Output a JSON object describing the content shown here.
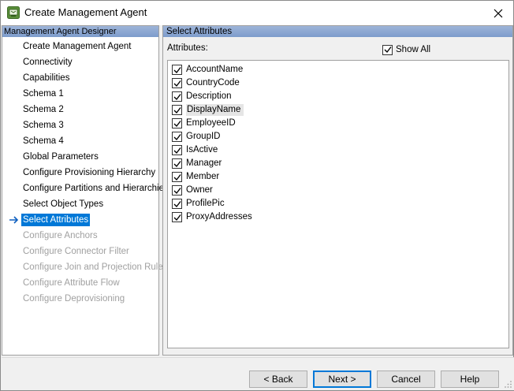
{
  "window": {
    "title": "Create Management Agent"
  },
  "left_pane": {
    "header": "Management Agent Designer",
    "items": [
      {
        "label": "Create Management Agent",
        "state": "normal"
      },
      {
        "label": "Connectivity",
        "state": "normal"
      },
      {
        "label": "Capabilities",
        "state": "normal"
      },
      {
        "label": "Schema 1",
        "state": "normal"
      },
      {
        "label": "Schema 2",
        "state": "normal"
      },
      {
        "label": "Schema 3",
        "state": "normal"
      },
      {
        "label": "Schema 4",
        "state": "normal"
      },
      {
        "label": "Global Parameters",
        "state": "normal"
      },
      {
        "label": "Configure Provisioning Hierarchy",
        "state": "normal"
      },
      {
        "label": "Configure Partitions and Hierarchies",
        "state": "normal"
      },
      {
        "label": "Select Object Types",
        "state": "normal"
      },
      {
        "label": "Select Attributes",
        "state": "selected"
      },
      {
        "label": "Configure Anchors",
        "state": "disabled"
      },
      {
        "label": "Configure Connector Filter",
        "state": "disabled"
      },
      {
        "label": "Configure Join and Projection Rules",
        "state": "disabled"
      },
      {
        "label": "Configure Attribute Flow",
        "state": "disabled"
      },
      {
        "label": "Configure Deprovisioning",
        "state": "disabled"
      }
    ]
  },
  "right_pane": {
    "header": "Select Attributes",
    "attributes_label": "Attributes:",
    "show_all_label": "Show All",
    "show_all_checked": true,
    "attributes": [
      {
        "name": "AccountName",
        "checked": true
      },
      {
        "name": "CountryCode",
        "checked": true
      },
      {
        "name": "Description",
        "checked": true
      },
      {
        "name": "DisplayName",
        "checked": true
      },
      {
        "name": "EmployeeID",
        "checked": true
      },
      {
        "name": "GroupID",
        "checked": true
      },
      {
        "name": "IsActive",
        "checked": true
      },
      {
        "name": "Manager",
        "checked": true
      },
      {
        "name": "Member",
        "checked": true
      },
      {
        "name": "Owner",
        "checked": true
      },
      {
        "name": "ProfilePic",
        "checked": true
      },
      {
        "name": "ProxyAddresses",
        "checked": true
      }
    ]
  },
  "footer": {
    "back_label": "< Back",
    "next_label": "Next >",
    "cancel_label": "Cancel",
    "help_label": "Help"
  },
  "icons": {
    "app": "management-agent-icon",
    "close": "close-icon",
    "current_step": "arrow-right-icon",
    "check": "checkmark-icon"
  },
  "colors": {
    "selection": "#0078d7",
    "header_band": "#8aa6d2",
    "disabled_text": "#a0a0a0"
  }
}
